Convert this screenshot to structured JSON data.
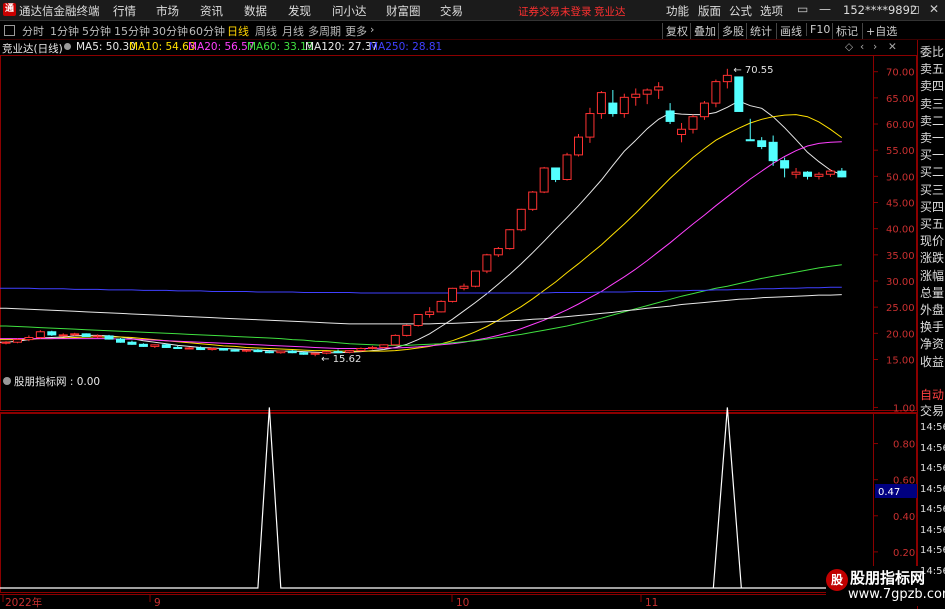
{
  "app": {
    "title": "通达信金融终端",
    "logo_icon": "tdx-logo-icon"
  },
  "menu": [
    "行情",
    "市场",
    "资讯",
    "数据",
    "发现",
    "问小达",
    "财富圈",
    "交易"
  ],
  "warning": "证券交易未登录",
  "stock_link": "竞业达",
  "right_menu": [
    "功能",
    "版面",
    "公式",
    "选项"
  ],
  "account": "152****9892",
  "window_controls": [
    "▭",
    "—",
    "◻",
    "✕"
  ],
  "periods": [
    {
      "label": "分时",
      "active": false
    },
    {
      "label": "1分钟",
      "active": false
    },
    {
      "label": "5分钟",
      "active": false
    },
    {
      "label": "15分钟",
      "active": false
    },
    {
      "label": "30分钟",
      "active": false
    },
    {
      "label": "60分钟",
      "active": false
    },
    {
      "label": "日线",
      "active": true
    },
    {
      "label": "周线",
      "active": false
    },
    {
      "label": "月线",
      "active": false
    },
    {
      "label": "多周期",
      "active": false
    },
    {
      "label": "更多",
      "active": false
    }
  ],
  "toolbar": [
    "复权",
    "叠加",
    "多股",
    "统计",
    "画线",
    "F10",
    "标记",
    "+自选"
  ],
  "info": {
    "stock": "竞业达(日线)",
    "ma": [
      {
        "name": "MA5: 50.30",
        "color": "#e8e8e8"
      },
      {
        "name": "MA10: 54.63",
        "color": "#ffe000"
      },
      {
        "name": "MA20: 56.57",
        "color": "#ff40ff"
      },
      {
        "name": "MA60: 33.13",
        "color": "#40e040"
      },
      {
        "name": "MA120: 27.37",
        "color": "#e8e8e8"
      },
      {
        "name": "MA250: 28.81",
        "color": "#4040ff"
      }
    ]
  },
  "indicator": {
    "label": "股朋指标网 : 0.00",
    "value_tag": "0.47"
  },
  "sidebar": {
    "labels": [
      "委比",
      "卖五",
      "卖四",
      "卖三",
      "卖二",
      "卖一",
      "买一",
      "买二",
      "买三",
      "买四",
      "买五",
      "现价",
      "涨跌",
      "涨幅",
      "总量",
      "外盘",
      "换手",
      "净资",
      "收益"
    ],
    "trade_labels": [
      "自动",
      "交易"
    ],
    "times": [
      "14:56",
      "14:56",
      "14:56",
      "14:56",
      "14:56",
      "14:56",
      "14:56",
      "14:56"
    ]
  },
  "watermark": {
    "line1": "股朋指标网",
    "line2": "www.7gpzb.com",
    "logo": "股"
  },
  "chart_data": [
    {
      "type": "candlestick",
      "y_ticks": [
        70.0,
        65.0,
        60.0,
        55.0,
        50.0,
        45.0,
        40.0,
        35.0,
        30.0,
        25.0,
        20.0,
        15.0
      ],
      "ylim": [
        12.8,
        73.0
      ],
      "annotations": [
        {
          "text": "70.55",
          "value": 70.55
        },
        {
          "text": "15.62",
          "value": 15.62
        }
      ],
      "candles": [
        [
          18.2,
          18.5,
          17.9,
          18.3
        ],
        [
          18.3,
          19.0,
          18.1,
          18.8
        ],
        [
          18.8,
          19.6,
          18.5,
          19.2
        ],
        [
          19.2,
          20.6,
          19.0,
          20.3
        ],
        [
          20.3,
          20.5,
          19.5,
          19.7
        ],
        [
          19.7,
          20.0,
          19.4,
          19.7
        ],
        [
          19.7,
          20.1,
          19.5,
          19.9
        ],
        [
          19.9,
          20.0,
          19.3,
          19.4
        ],
        [
          19.4,
          19.8,
          19.1,
          19.5
        ],
        [
          19.5,
          19.7,
          18.8,
          18.9
        ],
        [
          18.9,
          19.1,
          18.2,
          18.3
        ],
        [
          18.3,
          18.6,
          17.8,
          17.9
        ],
        [
          17.9,
          18.1,
          17.4,
          17.5
        ],
        [
          17.5,
          17.9,
          17.2,
          17.8
        ],
        [
          17.8,
          18.0,
          17.2,
          17.3
        ],
        [
          17.3,
          17.6,
          17.0,
          17.1
        ],
        [
          17.1,
          17.4,
          16.9,
          17.2
        ],
        [
          17.2,
          17.5,
          16.8,
          16.9
        ],
        [
          16.9,
          17.3,
          16.7,
          17.1
        ],
        [
          17.1,
          17.2,
          16.7,
          16.8
        ],
        [
          16.8,
          17.0,
          16.5,
          16.6
        ],
        [
          16.6,
          16.9,
          16.4,
          16.8
        ],
        [
          16.8,
          17.0,
          16.4,
          16.5
        ],
        [
          16.5,
          16.8,
          16.2,
          16.3
        ],
        [
          16.3,
          16.7,
          16.1,
          16.6
        ],
        [
          16.6,
          16.8,
          16.2,
          16.3
        ],
        [
          16.3,
          16.5,
          15.9,
          16.0
        ],
        [
          16.0,
          16.3,
          15.62,
          16.2
        ],
        [
          16.2,
          16.6,
          16.0,
          16.5
        ],
        [
          16.5,
          16.9,
          16.3,
          16.4
        ],
        [
          16.4,
          16.8,
          16.2,
          16.7
        ],
        [
          16.7,
          17.3,
          16.5,
          17.1
        ],
        [
          17.1,
          17.6,
          16.9,
          17.3
        ],
        [
          17.3,
          17.9,
          17.1,
          17.8
        ],
        [
          17.8,
          19.8,
          17.7,
          19.6
        ],
        [
          19.6,
          21.7,
          19.4,
          21.5
        ],
        [
          21.5,
          23.7,
          21.3,
          23.6
        ],
        [
          23.6,
          25.0,
          23.0,
          24.1
        ],
        [
          24.1,
          26.3,
          24.0,
          26.1
        ],
        [
          26.1,
          28.7,
          25.9,
          28.6
        ],
        [
          28.6,
          29.5,
          28.2,
          29.0
        ],
        [
          29.0,
          32.0,
          28.8,
          31.9
        ],
        [
          31.9,
          35.2,
          31.5,
          35.0
        ],
        [
          35.0,
          36.5,
          34.6,
          36.2
        ],
        [
          36.2,
          39.9,
          36.0,
          39.8
        ],
        [
          39.8,
          43.8,
          39.5,
          43.7
        ],
        [
          43.7,
          47.2,
          43.4,
          47.0
        ],
        [
          47.0,
          51.8,
          46.8,
          51.6
        ],
        [
          51.6,
          49.9,
          48.9,
          49.4
        ],
        [
          49.4,
          54.5,
          49.2,
          54.1
        ],
        [
          54.1,
          58.1,
          53.8,
          57.5
        ],
        [
          57.5,
          63.1,
          56.4,
          62.0
        ],
        [
          62.0,
          66.3,
          61.0,
          66.0
        ],
        [
          64.0,
          66.5,
          61.4,
          62.0
        ],
        [
          62.0,
          65.8,
          61.2,
          65.1
        ],
        [
          65.1,
          66.8,
          63.5,
          65.7
        ],
        [
          65.7,
          66.8,
          63.8,
          66.5
        ],
        [
          66.5,
          68.0,
          64.8,
          67.1
        ],
        [
          62.5,
          64.0,
          60.0,
          60.5
        ],
        [
          58.0,
          60.2,
          56.5,
          59.0
        ],
        [
          59.0,
          61.8,
          58.2,
          61.4
        ],
        [
          61.4,
          64.4,
          60.8,
          64.0
        ],
        [
          64.0,
          68.5,
          63.2,
          68.1
        ],
        [
          68.1,
          70.55,
          66.8,
          69.3
        ],
        [
          69.0,
          69.0,
          62.4,
          62.4
        ],
        [
          57.0,
          61.0,
          56.8,
          56.8
        ],
        [
          56.8,
          57.5,
          55.2,
          55.7
        ],
        [
          56.5,
          57.8,
          52.0,
          53.0
        ],
        [
          53.0,
          53.6,
          49.8,
          51.6
        ],
        [
          50.4,
          51.6,
          49.6,
          50.8
        ],
        [
          50.8,
          51.0,
          49.4,
          50.0
        ],
        [
          50.0,
          50.8,
          49.4,
          50.4
        ],
        [
          50.4,
          51.4,
          49.9,
          51.0
        ],
        [
          51.0,
          51.6,
          49.8,
          49.9
        ]
      ],
      "series": [
        {
          "name": "MA5",
          "color": "#e8e8e8",
          "values": [
            18.3,
            18.5,
            18.8,
            19.1,
            19.2,
            19.3,
            19.5,
            19.6,
            19.6,
            19.5,
            19.3,
            19.0,
            18.6,
            18.3,
            18.0,
            17.7,
            17.5,
            17.3,
            17.2,
            17.1,
            17.0,
            16.9,
            16.8,
            16.7,
            16.6,
            16.6,
            16.5,
            16.4,
            16.3,
            16.3,
            16.4,
            16.5,
            16.7,
            16.9,
            17.3,
            17.9,
            18.8,
            19.9,
            21.3,
            22.7,
            24.3,
            25.9,
            27.6,
            29.4,
            31.3,
            33.3,
            35.4,
            37.6,
            39.9,
            42.1,
            44.4,
            46.8,
            49.3,
            52.1,
            54.8,
            56.9,
            59.1,
            60.9,
            62.1,
            61.9,
            61.8,
            61.8,
            62.2,
            63.2,
            64.4,
            63.5,
            63.0,
            61.4,
            59.3,
            57.0,
            54.6,
            52.8,
            51.2,
            50.3
          ]
        },
        {
          "name": "MA10",
          "color": "#ffe000",
          "values": [
            18.8,
            18.8,
            18.9,
            19.0,
            19.0,
            19.1,
            19.2,
            19.3,
            19.3,
            19.3,
            19.3,
            19.2,
            19.0,
            18.8,
            18.6,
            18.4,
            18.2,
            18.0,
            17.8,
            17.6,
            17.5,
            17.3,
            17.2,
            17.1,
            17.0,
            16.9,
            16.8,
            16.7,
            16.7,
            16.6,
            16.6,
            16.6,
            16.6,
            16.6,
            16.7,
            16.9,
            17.2,
            17.5,
            18.0,
            18.6,
            19.4,
            20.3,
            21.3,
            22.5,
            23.8,
            25.1,
            26.6,
            28.2,
            29.8,
            31.6,
            33.3,
            35.1,
            36.9,
            38.9,
            40.9,
            43.0,
            45.2,
            47.4,
            49.6,
            51.6,
            53.6,
            55.3,
            56.9,
            58.1,
            59.2,
            60.2,
            60.9,
            61.4,
            61.7,
            61.8,
            61.4,
            60.4,
            59.0,
            57.4
          ]
        },
        {
          "name": "MA20",
          "color": "#ff40ff",
          "values": [
            19.0,
            19.0,
            19.0,
            19.0,
            19.0,
            19.0,
            19.0,
            19.0,
            19.0,
            19.0,
            18.9,
            18.9,
            18.8,
            18.7,
            18.6,
            18.5,
            18.4,
            18.3,
            18.2,
            18.1,
            18.0,
            17.9,
            17.8,
            17.7,
            17.6,
            17.5,
            17.4,
            17.3,
            17.2,
            17.1,
            17.1,
            17.1,
            17.1,
            17.2,
            17.2,
            17.3,
            17.4,
            17.6,
            17.8,
            18.0,
            18.3,
            18.7,
            19.1,
            19.6,
            20.2,
            20.9,
            21.7,
            22.5,
            23.5,
            24.5,
            25.6,
            26.8,
            28.0,
            29.4,
            30.8,
            32.3,
            33.9,
            35.6,
            37.3,
            39.1,
            40.9,
            42.6,
            44.4,
            46.1,
            47.8,
            49.5,
            51.0,
            52.5,
            53.8,
            54.9,
            55.8,
            56.3,
            56.5,
            56.6
          ]
        },
        {
          "name": "MA60",
          "color": "#40e040",
          "values": [
            21.4,
            21.3,
            21.2,
            21.1,
            21.0,
            20.9,
            20.8,
            20.7,
            20.6,
            20.5,
            20.4,
            20.3,
            20.2,
            20.1,
            20.0,
            19.9,
            19.8,
            19.7,
            19.6,
            19.5,
            19.4,
            19.3,
            19.2,
            19.1,
            19.0,
            18.8,
            18.7,
            18.5,
            18.4,
            18.2,
            18.0,
            17.9,
            17.8,
            17.7,
            17.7,
            17.7,
            17.8,
            17.9,
            18.0,
            18.2,
            18.4,
            18.6,
            18.9,
            19.2,
            19.5,
            19.8,
            20.2,
            20.6,
            21.0,
            21.4,
            21.9,
            22.4,
            22.9,
            23.5,
            24.1,
            24.7,
            25.3,
            25.9,
            26.5,
            27.1,
            27.6,
            28.1,
            28.6,
            29.0,
            29.5,
            30.0,
            30.5,
            30.9,
            31.3,
            31.7,
            32.1,
            32.5,
            32.8,
            33.1
          ]
        },
        {
          "name": "MA120",
          "color": "#e8e8e8",
          "values": [
            24.8,
            24.7,
            24.6,
            24.5,
            24.4,
            24.3,
            24.2,
            24.1,
            24.0,
            23.9,
            23.8,
            23.7,
            23.6,
            23.5,
            23.4,
            23.3,
            23.2,
            23.1,
            23.0,
            22.9,
            22.8,
            22.7,
            22.6,
            22.5,
            22.4,
            22.3,
            22.2,
            22.1,
            22.0,
            21.9,
            21.8,
            21.8,
            21.8,
            21.8,
            21.8,
            21.8,
            21.8,
            21.8,
            21.9,
            21.9,
            22.0,
            22.1,
            22.2,
            22.3,
            22.4,
            22.5,
            22.7,
            22.8,
            23.0,
            23.2,
            23.4,
            23.6,
            23.8,
            24.0,
            24.3,
            24.5,
            24.8,
            25.0,
            25.2,
            25.5,
            25.7,
            25.9,
            26.1,
            26.3,
            26.5,
            26.6,
            26.8,
            26.9,
            27.0,
            27.1,
            27.2,
            27.3,
            27.3,
            27.4
          ]
        },
        {
          "name": "MA250",
          "color": "#4040ff",
          "values": [
            28.6,
            28.6,
            28.6,
            28.5,
            28.5,
            28.5,
            28.4,
            28.4,
            28.4,
            28.3,
            28.3,
            28.3,
            28.2,
            28.2,
            28.2,
            28.1,
            28.1,
            28.1,
            28.0,
            28.0,
            28.0,
            28.0,
            27.9,
            27.9,
            27.9,
            27.9,
            27.8,
            27.8,
            27.8,
            27.8,
            27.8,
            27.7,
            27.7,
            27.7,
            27.7,
            27.7,
            27.7,
            27.7,
            27.7,
            27.7,
            27.7,
            27.7,
            27.7,
            27.7,
            27.7,
            27.7,
            27.7,
            27.7,
            27.8,
            27.8,
            27.8,
            27.8,
            27.9,
            27.9,
            27.9,
            28.0,
            28.0,
            28.0,
            28.1,
            28.1,
            28.2,
            28.2,
            28.3,
            28.3,
            28.4,
            28.4,
            28.5,
            28.5,
            28.6,
            28.6,
            28.7,
            28.7,
            28.8,
            28.8
          ]
        }
      ]
    },
    {
      "type": "line",
      "name": "股朋指标网",
      "color": "#ffffff",
      "y_ticks": [
        1.0,
        0.8,
        0.6,
        0.4,
        0.2,
        0.0
      ],
      "ylim": [
        0,
        1.08
      ],
      "values": [
        0,
        0,
        0,
        0,
        0,
        0,
        0,
        0,
        0,
        0,
        0,
        0,
        0,
        0,
        0,
        0,
        0,
        0,
        0,
        0,
        0,
        0,
        0,
        1,
        0,
        0,
        0,
        0,
        0,
        0,
        0,
        0,
        0,
        0,
        0,
        0,
        0,
        0,
        0,
        0,
        0,
        0,
        0,
        0,
        0,
        0,
        0,
        0,
        0,
        0,
        0,
        0,
        0,
        0,
        0,
        0,
        0,
        0,
        0,
        0,
        0,
        0,
        0,
        0,
        0,
        0,
        0,
        0,
        0,
        0,
        0,
        0,
        0,
        0
      ]
    }
  ],
  "date_axis": {
    "labels": [
      "2022年",
      "9",
      "10",
      "11"
    ]
  }
}
